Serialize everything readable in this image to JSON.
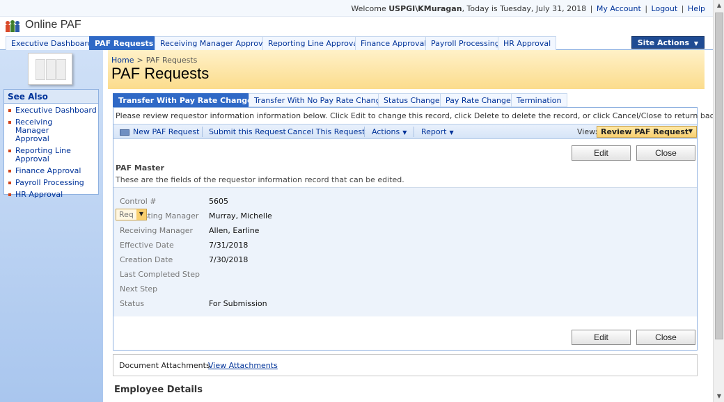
{
  "topbar": {
    "welcome": "Welcome",
    "user": "USPGI\\KMuragan",
    "today": ", Today is Tuesday, July 31, 2018",
    "my_account": "My Account",
    "logout": "Logout",
    "help": "Help"
  },
  "site": {
    "title": "Online PAF"
  },
  "topnav": {
    "tabs": [
      "Executive Dashboard",
      "PAF Requests",
      "Receiving Manager Approval",
      "Reporting Line Approval",
      "Finance Approval",
      "Payroll Processing",
      "HR Approval"
    ],
    "active": "PAF Requests",
    "site_actions": "Site Actions"
  },
  "leftnav": {
    "header": "See Also",
    "items": [
      "Executive Dashboard",
      "Receiving Manager Approval",
      "Reporting Line Approval",
      "Finance Approval",
      "Payroll Processing",
      "HR Approval"
    ]
  },
  "header": {
    "breadcrumb_home": "Home",
    "breadcrumb_sep": ">",
    "breadcrumb_current": "PAF Requests",
    "title": "PAF Requests"
  },
  "subtabs": [
    "Transfer With Pay Rate Change",
    "Transfer With No Pay Rate Change",
    "Status Change",
    "Pay Rate Change",
    "Termination"
  ],
  "instruction": "Please review requestor information information below. Click Edit to change this record, click Delete to delete the record, or click Cancel/Close to return back.",
  "toolbar": {
    "new_request": "New PAF Request",
    "submit": "Submit this Request",
    "cancel": "Cancel This Request",
    "actions": "Actions",
    "report": "Report",
    "view_label": "View:",
    "view_value": "Review PAF Request"
  },
  "buttons": {
    "edit": "Edit",
    "close": "Close"
  },
  "master": {
    "label": "PAF Master",
    "description": "These are the fields of the requestor information record that can be edited.",
    "fields": [
      {
        "label": "Control #",
        "value": "5605"
      },
      {
        "label": "Requesting Manager",
        "value": "Murray, Michelle"
      },
      {
        "label": "Receiving Manager",
        "value": "Allen, Earline"
      },
      {
        "label": "Effective Date",
        "value": "7/31/2018"
      },
      {
        "label": "Creation Date",
        "value": "7/30/2018"
      },
      {
        "label": "Last Completed Step",
        "value": ""
      },
      {
        "label": "Next Step",
        "value": ""
      },
      {
        "label": "Status",
        "value": "For Submission"
      }
    ],
    "field_menu_text": "Req"
  },
  "attachments": {
    "label": "Document Attachments",
    "link": "View Attachments"
  },
  "employee_details": "Employee Details"
}
